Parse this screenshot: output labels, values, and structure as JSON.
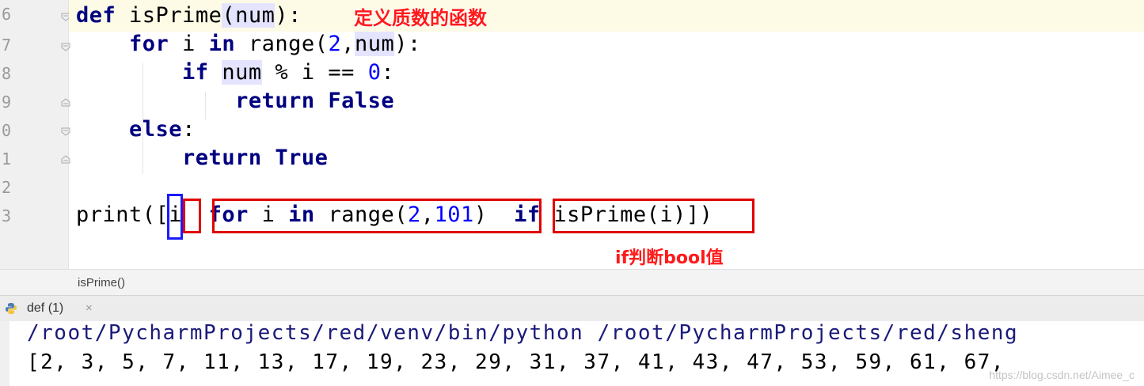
{
  "line_numbers": [
    "6",
    "7",
    "8",
    "9",
    "0",
    "1",
    "2",
    "3"
  ],
  "code": {
    "line1": {
      "kw": "def",
      "name": "isPrime",
      "open": "(",
      "param": "num",
      "close": "):"
    },
    "line2": {
      "kw1": "for",
      "var": "i",
      "kw2": "in",
      "fn": "range",
      "open": "(",
      "n1": "2",
      "comma": ",",
      "param": "num",
      "close": "):"
    },
    "line3": {
      "kw": "if",
      "param": "num",
      "op": "% i ==",
      "n": "0",
      "colon": ":"
    },
    "line4": {
      "kw1": "return",
      "kw2": "False"
    },
    "line5": {
      "kw": "else",
      "colon": ":"
    },
    "line6": {
      "kw1": "return",
      "kw2": "True"
    },
    "line8": {
      "fn": "print",
      "open": "([",
      "var": "i",
      "kw1": "for",
      "var2": "i",
      "kw2": "in",
      "fn2": "range",
      "open2": "(",
      "n1": "2",
      "comma": ",",
      "n2": "101",
      "close2": ")",
      "kw3": "if",
      "call": "isPrime(i)",
      "close": "])"
    }
  },
  "annotations": {
    "top": "定义质数的函数",
    "bottom": "if判断bool值"
  },
  "breadcrumb": "isPrime()",
  "run_tab": {
    "label": "def (1)",
    "close": "×"
  },
  "console": {
    "command": "/root/PycharmProjects/red/venv/bin/python /root/PycharmProjects/red/sheng",
    "output": "[2, 3, 5, 7, 11, 13, 17, 19, 23, 29, 31, 37, 41, 43, 47, 53, 59, 61, 67,"
  },
  "watermark": "https://blog.csdn.net/Aimee_c",
  "colors": {
    "keyword": "#000080",
    "number": "#0000ff",
    "annotation": "#ff1a1a",
    "box_red": "#e00000",
    "box_blue": "#1a1aff"
  }
}
